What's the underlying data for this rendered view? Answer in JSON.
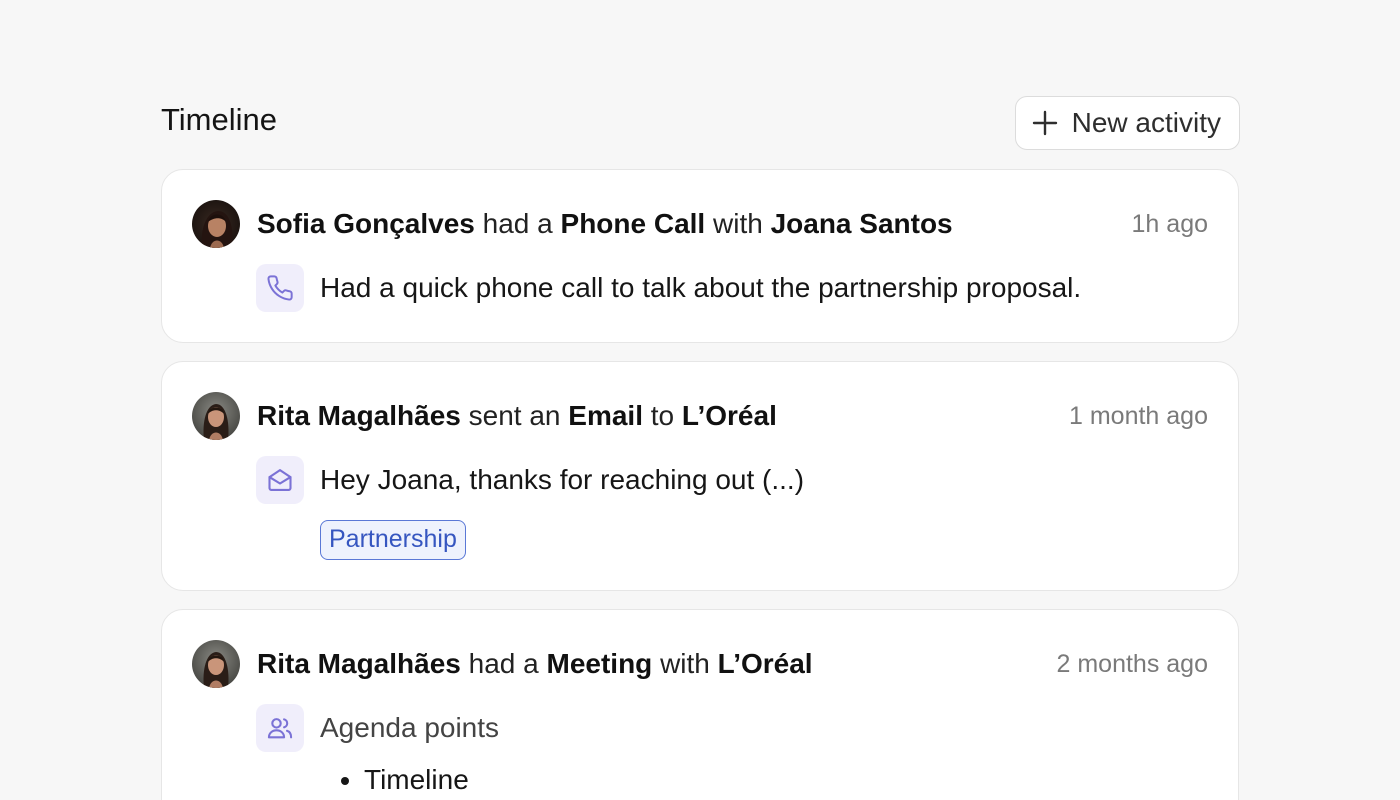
{
  "header": {
    "title": "Timeline",
    "new_activity_label": "New activity"
  },
  "colors": {
    "background": "#f7f7f7",
    "card": "#ffffff",
    "icon_accent": "#7b72d6",
    "icon_bg": "#f0eefb",
    "tag_border": "#5a78d6",
    "tag_text": "#3656c0"
  },
  "activities": [
    {
      "actor": "Sofia Gonçalves",
      "verb": "had a",
      "type": "Phone Call",
      "preposition": "with",
      "target": "Joana Santos",
      "time": "1h ago",
      "icon": "phone-icon",
      "body": "Had a quick phone call to talk about the partnership proposal."
    },
    {
      "actor": "Rita Magalhães",
      "verb": "sent an",
      "type": "Email",
      "preposition": "to",
      "target": "L’Oréal",
      "time": "1 month ago",
      "icon": "envelope-icon",
      "body": "Hey Joana, thanks for reaching out (...)",
      "tag": "Partnership"
    },
    {
      "actor": "Rita Magalhães",
      "verb": "had a",
      "type": "Meeting",
      "preposition": "with",
      "target": "L’Oréal",
      "time": "2 months ago",
      "icon": "users-icon",
      "body": "Agenda points",
      "agenda": [
        "Timeline"
      ]
    }
  ]
}
